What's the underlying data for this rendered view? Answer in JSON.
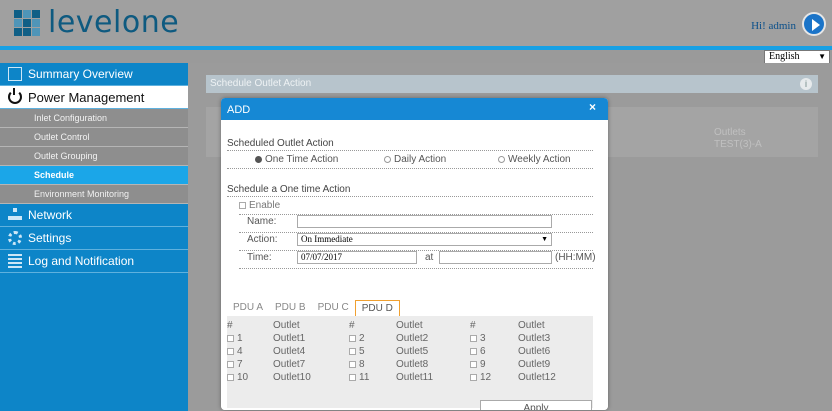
{
  "header": {
    "brand": "levelone",
    "greeting": "Hi! admin"
  },
  "language": {
    "selected": "English"
  },
  "sidebar": {
    "items": [
      {
        "label": "Summary Overview",
        "icon": "document-icon"
      },
      {
        "label": "Power Management",
        "icon": "power-icon",
        "active": true
      },
      {
        "label": "Network",
        "icon": "network-icon"
      },
      {
        "label": "Settings",
        "icon": "gear-icon"
      },
      {
        "label": "Log and Notification",
        "icon": "log-icon"
      }
    ],
    "sub_items": [
      {
        "label": "Inlet Configuration"
      },
      {
        "label": "Outlet Control"
      },
      {
        "label": "Outlet Grouping"
      },
      {
        "label": "Schedule",
        "active": true
      },
      {
        "label": "Environment Monitoring"
      }
    ]
  },
  "page": {
    "title": "Schedule Outlet Action",
    "bg_column_header": "Outlets",
    "bg_column_value": "TEST(3)-A"
  },
  "modal": {
    "title": "ADD",
    "close": "×",
    "section1_label": "Scheduled Outlet Action",
    "radios": [
      {
        "label": "One Time Action",
        "checked": true
      },
      {
        "label": "Daily Action",
        "checked": false
      },
      {
        "label": "Weekly Action",
        "checked": false
      }
    ],
    "section2_label": "Schedule a One time Action",
    "enable_label": "Enable",
    "name_label": "Name:",
    "name_value": "",
    "action_label": "Action:",
    "action_value": "On Immediate",
    "time_label": "Time:",
    "date_value": "07/07/2017",
    "at_label": "at",
    "time_value": "",
    "time_unit": "(HH:MM)",
    "pdu_tabs": [
      {
        "label": "PDU A"
      },
      {
        "label": "PDU B"
      },
      {
        "label": "PDU C"
      },
      {
        "label": "PDU D",
        "active": true
      }
    ],
    "table_header": [
      "#",
      "Outlet",
      "#",
      "Outlet",
      "#",
      "Outlet"
    ],
    "rows": [
      [
        {
          "num": "1",
          "name": "Outlet1"
        },
        {
          "num": "2",
          "name": "Outlet2"
        },
        {
          "num": "3",
          "name": "Outlet3"
        }
      ],
      [
        {
          "num": "4",
          "name": "Outlet4"
        },
        {
          "num": "5",
          "name": "Outlet5"
        },
        {
          "num": "6",
          "name": "Outlet6"
        }
      ],
      [
        {
          "num": "7",
          "name": "Outlet7"
        },
        {
          "num": "8",
          "name": "Outlet8"
        },
        {
          "num": "9",
          "name": "Outlet9"
        }
      ],
      [
        {
          "num": "10",
          "name": "Outlet10"
        },
        {
          "num": "11",
          "name": "Outlet11"
        },
        {
          "num": "12",
          "name": "Outlet12"
        }
      ]
    ],
    "apply_label": "Apply"
  }
}
